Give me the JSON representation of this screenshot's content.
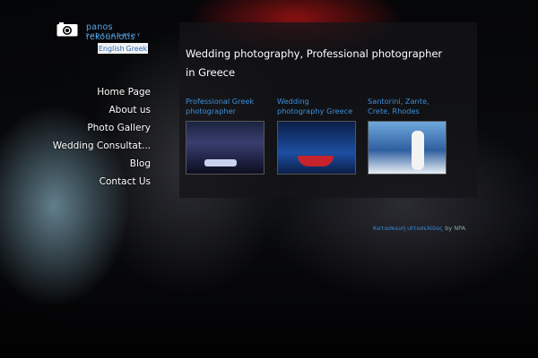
{
  "brand": {
    "name": "panos rekouniotis",
    "tagline": "PHOTOGRAPHY",
    "icon": "camera-icon"
  },
  "languages": [
    "English",
    "Greek"
  ],
  "nav": {
    "items": [
      "Home Page",
      "About us",
      "Photo Gallery",
      "Wedding Consultat...",
      "Blog",
      "Contact Us"
    ]
  },
  "main": {
    "title": "Wedding photography, Professional photographer in Greece",
    "cards": [
      {
        "label": "Professional Greek photographer"
      },
      {
        "label": "Wedding photography Greece"
      },
      {
        "label": "Santorini, Zante, Crete, Rhodes"
      }
    ]
  },
  "footer": {
    "link_text": "Κατασκευή ιστοσελίδας",
    "by_text": "by NPA"
  },
  "colors": {
    "link": "#3b8fd9",
    "logo": "#5aa6e6",
    "panel": "#141418"
  }
}
